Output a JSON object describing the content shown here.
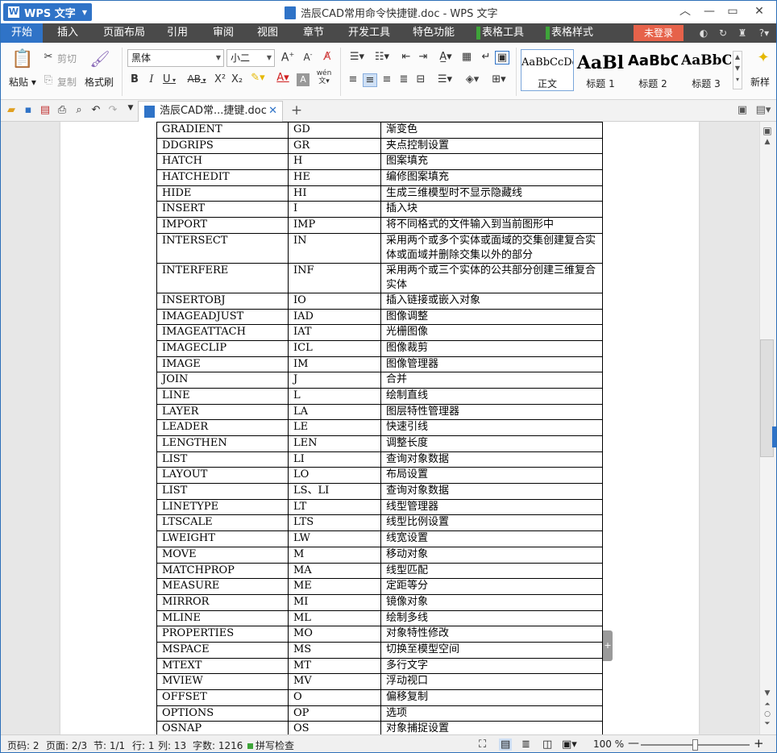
{
  "app": {
    "name": "WPS 文字",
    "window_title": "浩辰CAD常用命令快捷键.doc - WPS 文字",
    "login": "未登录"
  },
  "menu_tabs": [
    "开始",
    "插入",
    "页面布局",
    "引用",
    "审阅",
    "视图",
    "章节",
    "开发工具",
    "特色功能",
    "表格工具",
    "表格样式"
  ],
  "ribbon": {
    "paste": "粘贴",
    "cut": "剪切",
    "copy": "复制",
    "format_painter": "格式刷",
    "font_name": "黑体",
    "font_size": "小二",
    "bold": "B",
    "italic": "I",
    "underline": "U",
    "strike": "AB",
    "superscript": "X²",
    "subscript": "X₂",
    "wen": "wén",
    "styles": [
      {
        "sample": "AaBbCcDd",
        "name": "正文"
      },
      {
        "sample": "AaBl",
        "name": "标题 1"
      },
      {
        "sample": "AaBbC",
        "name": "标题 2"
      },
      {
        "sample": "AaBbC",
        "name": "标题 3"
      }
    ],
    "new_style": "新样"
  },
  "doc_tab": {
    "label": "浩辰CAD常...捷键.doc"
  },
  "table_rows": [
    [
      "GRADIENT",
      "GD",
      "渐变色"
    ],
    [
      "DDGRIPS",
      "GR",
      "夹点控制设置"
    ],
    [
      "HATCH",
      "H",
      "图案填充"
    ],
    [
      "HATCHEDIT",
      "HE",
      "编修图案填充"
    ],
    [
      "HIDE",
      "HI",
      "生成三维模型时不显示隐藏线"
    ],
    [
      "INSERT",
      "I",
      "插入块"
    ],
    [
      "IMPORT",
      "IMP",
      "将不同格式的文件输入到当前图形中"
    ],
    [
      "INTERSECT",
      "IN",
      "采用两个或多个实体或面域的交集创建复合实体或面域并删除交集以外的部分"
    ],
    [
      "INTERFERE",
      "INF",
      "采用两个或三个实体的公共部分创建三维复合实体"
    ],
    [
      "INSERTOBJ",
      "IO",
      "插入链接或嵌入对象"
    ],
    [
      "IMAGEADJUST",
      "IAD",
      "图像调整"
    ],
    [
      "IMAGEATTACH",
      "IAT",
      "光栅图像"
    ],
    [
      "IMAGECLIP",
      "ICL",
      "图像裁剪"
    ],
    [
      "IMAGE",
      "IM",
      "图像管理器"
    ],
    [
      "JOIN",
      "J",
      "合并"
    ],
    [
      "LINE",
      "L",
      "绘制直线"
    ],
    [
      "LAYER",
      "LA",
      "图层特性管理器"
    ],
    [
      "LEADER",
      "LE",
      "快速引线"
    ],
    [
      "LENGTHEN",
      "LEN",
      "调整长度"
    ],
    [
      "LIST",
      "LI",
      "查询对象数据"
    ],
    [
      "LAYOUT",
      "LO",
      "布局设置"
    ],
    [
      "LIST",
      "LS、LI",
      "查询对象数据"
    ],
    [
      "LINETYPE",
      "LT",
      "线型管理器"
    ],
    [
      "LTSCALE",
      "LTS",
      "线型比例设置"
    ],
    [
      "LWEIGHT",
      "LW",
      "线宽设置"
    ],
    [
      "MOVE",
      "M",
      "移动对象"
    ],
    [
      "MATCHPROP",
      "MA",
      "线型匹配"
    ],
    [
      "MEASURE",
      "ME",
      "定距等分"
    ],
    [
      "MIRROR",
      "MI",
      "镜像对象"
    ],
    [
      "MLINE",
      "ML",
      "绘制多线"
    ],
    [
      "PROPERTIES",
      "MO",
      "对象特性修改"
    ],
    [
      "MSPACE",
      "MS",
      "切换至模型空间"
    ],
    [
      "MTEXT",
      "MT",
      "多行文字"
    ],
    [
      "MVIEW",
      "MV",
      "浮动视口"
    ],
    [
      "OFFSET",
      "O",
      "偏移复制"
    ],
    [
      "OPTIONS",
      "OP",
      "选项"
    ],
    [
      "OSNAP",
      "OS",
      "对象捕捉设置"
    ]
  ],
  "status": {
    "page_code": "页码: 2",
    "page": "页面: 2/3",
    "section": "节: 1/1",
    "row": "行: 1",
    "col": "列: 13",
    "words": "字数: 1216",
    "spell": "拼写检查",
    "zoom": "100 %",
    "zoom_level": 1.0
  },
  "colors": {
    "accent": "#2f73c7",
    "menubar": "#4a4a4a",
    "login": "#e6624a",
    "table_tools": "#3ea43a"
  }
}
